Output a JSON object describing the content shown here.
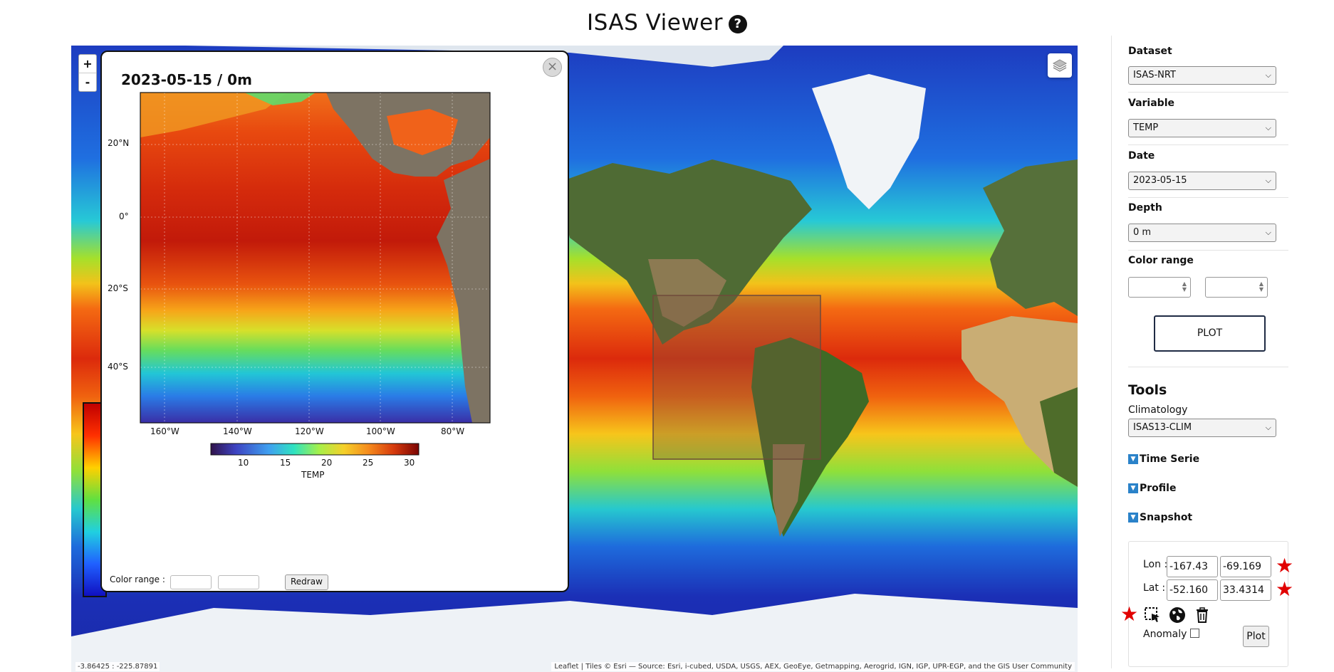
{
  "app": {
    "title": "ISAS Viewer",
    "help_icon": "help-circle-icon",
    "help_glyph": "?"
  },
  "map": {
    "zoom_in": "+",
    "zoom_out": "-",
    "layers_icon": "layers-icon",
    "coords_readout": "-3.86425 : -225.87891",
    "attribution": "Leaflet | Tiles © Esri — Source: Esri, i-cubed, USDA, USGS, AEX, GeoEye, Getmapping, Aerogrid, IGN, IGP, UPR-EGP, and the GIS User Community"
  },
  "popup": {
    "title": "2023-05-15 / 0m",
    "close_glyph": "×",
    "lat_ticks": [
      "20°N",
      "0°",
      "20°S",
      "40°S"
    ],
    "lon_ticks": [
      "160°W",
      "140°W",
      "120°W",
      "100°W",
      "80°W"
    ],
    "colorbar_ticks": [
      "10",
      "15",
      "20",
      "25",
      "30"
    ],
    "colorbar_label": "TEMP",
    "color_range_label": "Color range :",
    "redraw_label": "Redraw",
    "color_range_min": "",
    "color_range_max": ""
  },
  "panel": {
    "dataset_label": "Dataset",
    "dataset_value": "ISAS-NRT",
    "variable_label": "Variable",
    "variable_value": "TEMP",
    "date_label": "Date",
    "date_value": "2023-05-15",
    "depth_label": "Depth",
    "depth_value": "0 m",
    "color_range_label": "Color range",
    "color_range_min": "",
    "color_range_max": "",
    "plot_label": "PLOT",
    "tools_title": "Tools",
    "climatology_label": "Climatology",
    "climatology_value": "ISAS13-CLIM",
    "sections": [
      "Time Serie",
      "Profile",
      "Snapshot"
    ],
    "snapshot": {
      "lon_label": "Lon :",
      "lat_label": "Lat :",
      "lon_min": "-167.43",
      "lon_max": "-69.169",
      "lat_min": "-52.160",
      "lat_max": "33.4314",
      "anomaly_label": "Anomaly",
      "anomaly_checked": false,
      "plot_label": "Plot",
      "icons": [
        "select-area-icon",
        "globe-icon",
        "trash-icon"
      ],
      "required_marker": "★"
    }
  },
  "colors": {
    "accent": "#2a82c9",
    "required": "#e10000",
    "land": "#7d7363"
  }
}
